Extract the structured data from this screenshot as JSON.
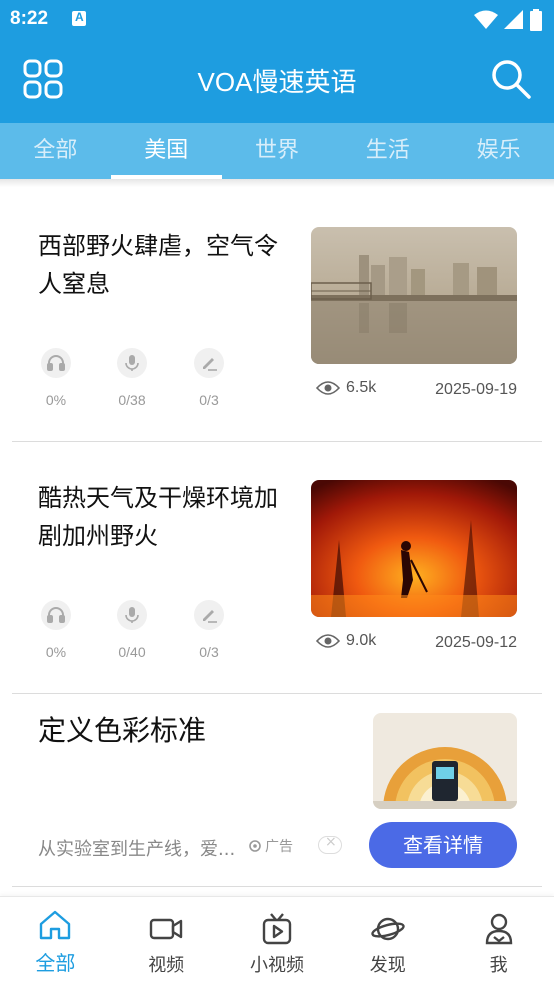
{
  "status_bar": {
    "time": "8:22"
  },
  "app_bar": {
    "title": "VOA慢速英语"
  },
  "tabs": [
    {
      "label": "全部",
      "active": false
    },
    {
      "label": "美国",
      "active": true
    },
    {
      "label": "世界",
      "active": false
    },
    {
      "label": "生活",
      "active": false
    },
    {
      "label": "娱乐",
      "active": false
    }
  ],
  "articles": [
    {
      "title": "西部野火肆虐，空气令人窒息",
      "listen_progress": "0%",
      "speak_progress": "0/38",
      "write_progress": "0/3",
      "views": "6.5k",
      "date": "2025-09-19"
    },
    {
      "title": "酷热天气及干燥环境加剧加州野火",
      "listen_progress": "0%",
      "speak_progress": "0/40",
      "write_progress": "0/3",
      "views": "9.0k",
      "date": "2025-09-12"
    }
  ],
  "ad": {
    "title": "定义色彩标准",
    "description": "从实验室到生产线，爱...",
    "tag": "广告",
    "button_label": "查看详情"
  },
  "bottom_nav": [
    {
      "label": "全部",
      "icon": "home-icon",
      "active": true
    },
    {
      "label": "视频",
      "icon": "video-camera-icon",
      "active": false
    },
    {
      "label": "小视频",
      "icon": "tv-play-icon",
      "active": false
    },
    {
      "label": "发现",
      "icon": "planet-icon",
      "active": false
    },
    {
      "label": "我",
      "icon": "person-icon",
      "active": false
    }
  ],
  "colors": {
    "primary": "#1e9de0",
    "tab_bar": "#5cbbea",
    "ad_button": "#4b6ae6"
  }
}
